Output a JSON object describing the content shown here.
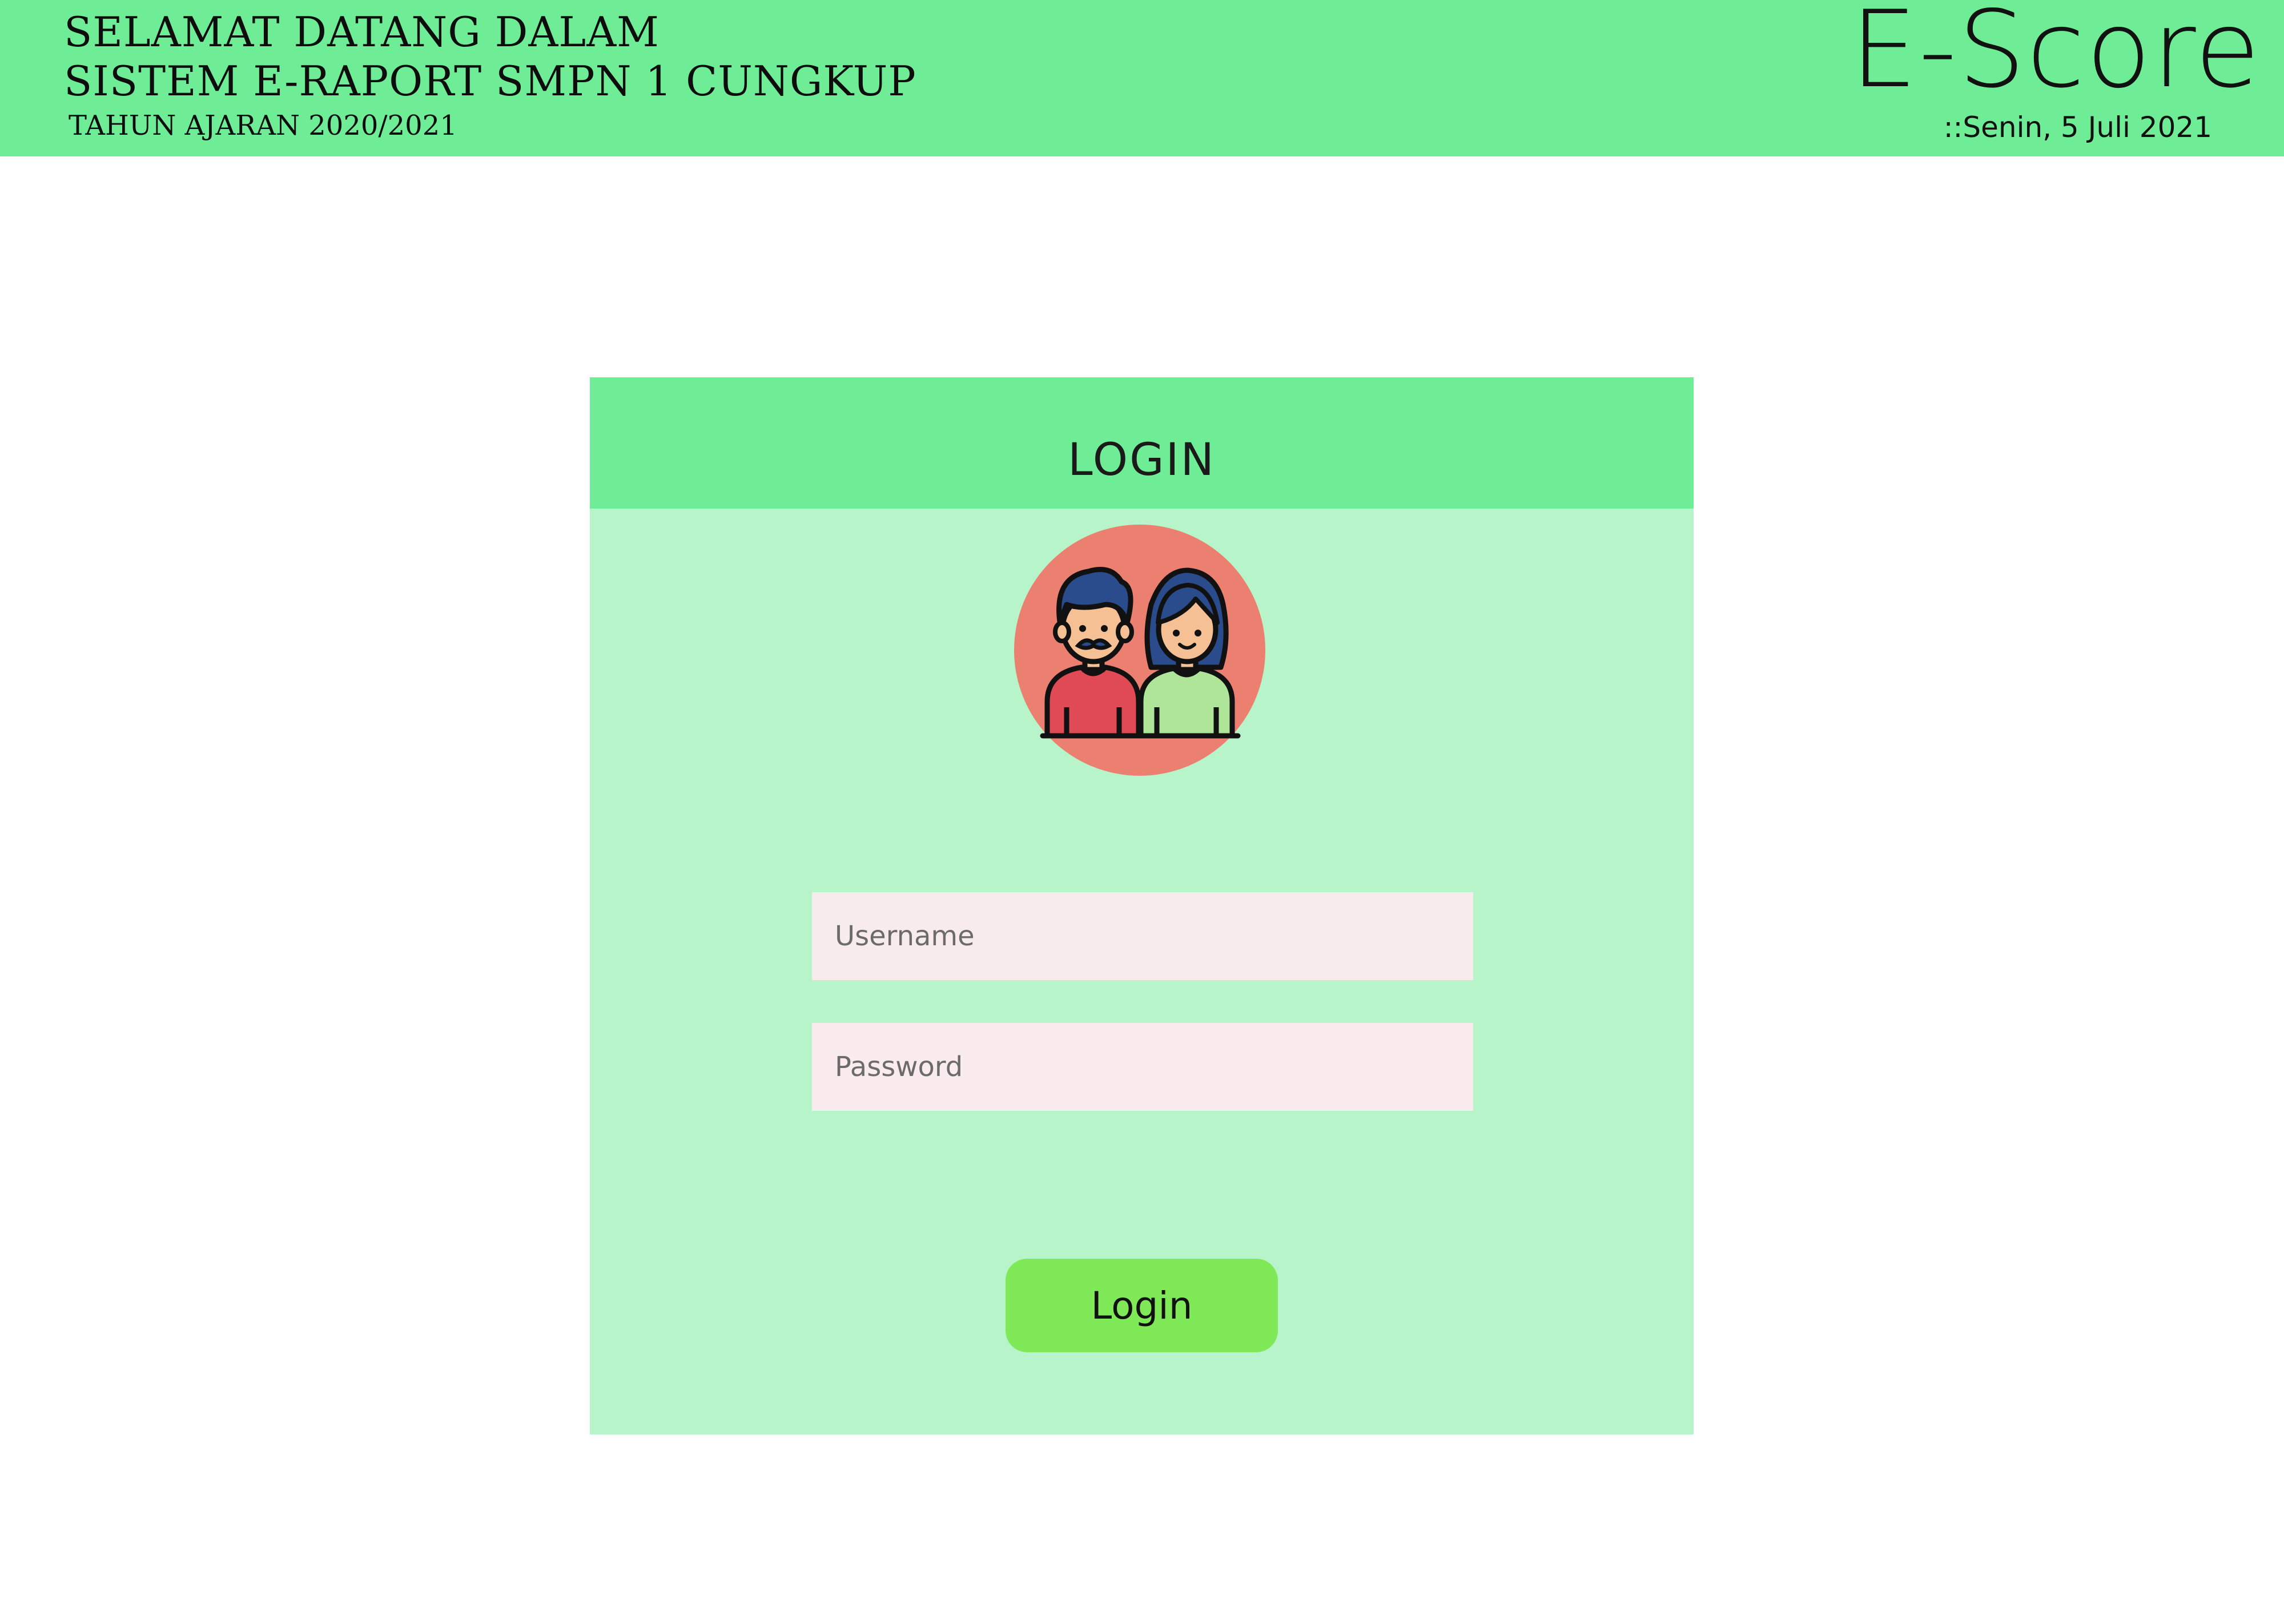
{
  "header": {
    "welcome_line1": "SELAMAT DATANG DALAM",
    "welcome_line2": "SISTEM E-RAPORT SMPN 1 CUNGKUP",
    "school_year": "TAHUN AJARAN  2020/2021",
    "brand": "E-Score",
    "date": "::Senin, 5 Juli 2021"
  },
  "login": {
    "title": "LOGIN",
    "avatar_icon": "users-couple-icon",
    "username_placeholder": "Username",
    "password_placeholder": "Password",
    "button_label": "Login"
  },
  "colors": {
    "header_green": "#6fec96",
    "card_bg": "#b7f4c9",
    "button_green": "#80e958",
    "avatar_circle": "#eb8070"
  }
}
